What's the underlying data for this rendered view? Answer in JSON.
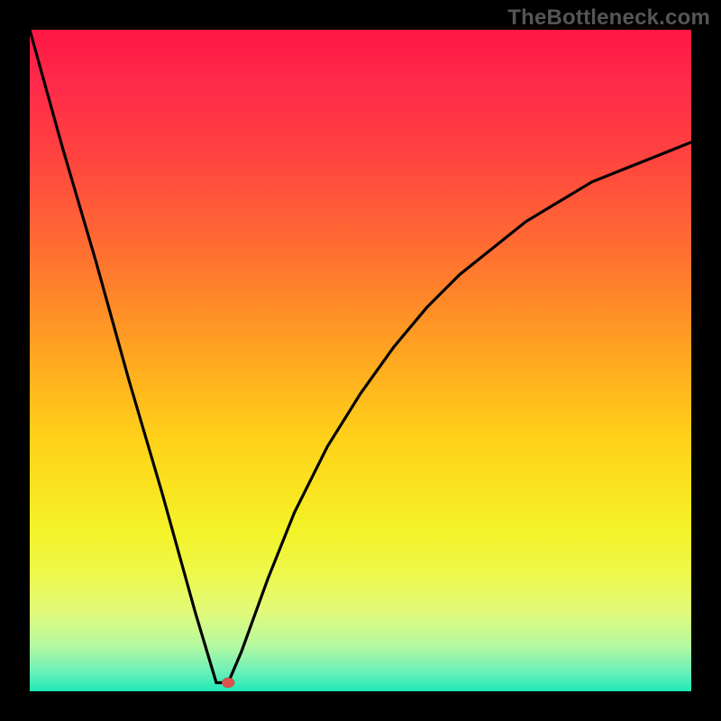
{
  "watermark": {
    "text": "TheBottleneck.com"
  },
  "chart_data": {
    "type": "line",
    "title": "",
    "xlabel": "",
    "ylabel": "",
    "xlim": [
      0,
      1
    ],
    "ylim": [
      0,
      1
    ],
    "series": [
      {
        "name": "curve",
        "x": [
          0.0,
          0.05,
          0.1,
          0.15,
          0.2,
          0.25,
          0.282,
          0.3,
          0.32,
          0.36,
          0.4,
          0.45,
          0.5,
          0.55,
          0.6,
          0.65,
          0.7,
          0.75,
          0.8,
          0.85,
          0.9,
          0.95,
          1.0
        ],
        "y": [
          1.0,
          0.82,
          0.65,
          0.47,
          0.3,
          0.12,
          0.013,
          0.013,
          0.06,
          0.17,
          0.27,
          0.37,
          0.45,
          0.52,
          0.58,
          0.63,
          0.67,
          0.71,
          0.74,
          0.77,
          0.79,
          0.81,
          0.83
        ]
      }
    ],
    "marker": {
      "x": 0.3,
      "y": 0.013,
      "color": "#d9534f"
    },
    "gradient_stops": [
      {
        "pos": 0.0,
        "color": "#ff1744"
      },
      {
        "pos": 0.5,
        "color": "#ffd21a"
      },
      {
        "pos": 0.8,
        "color": "#f3f32a"
      },
      {
        "pos": 1.0,
        "color": "#1de9b6"
      }
    ]
  }
}
